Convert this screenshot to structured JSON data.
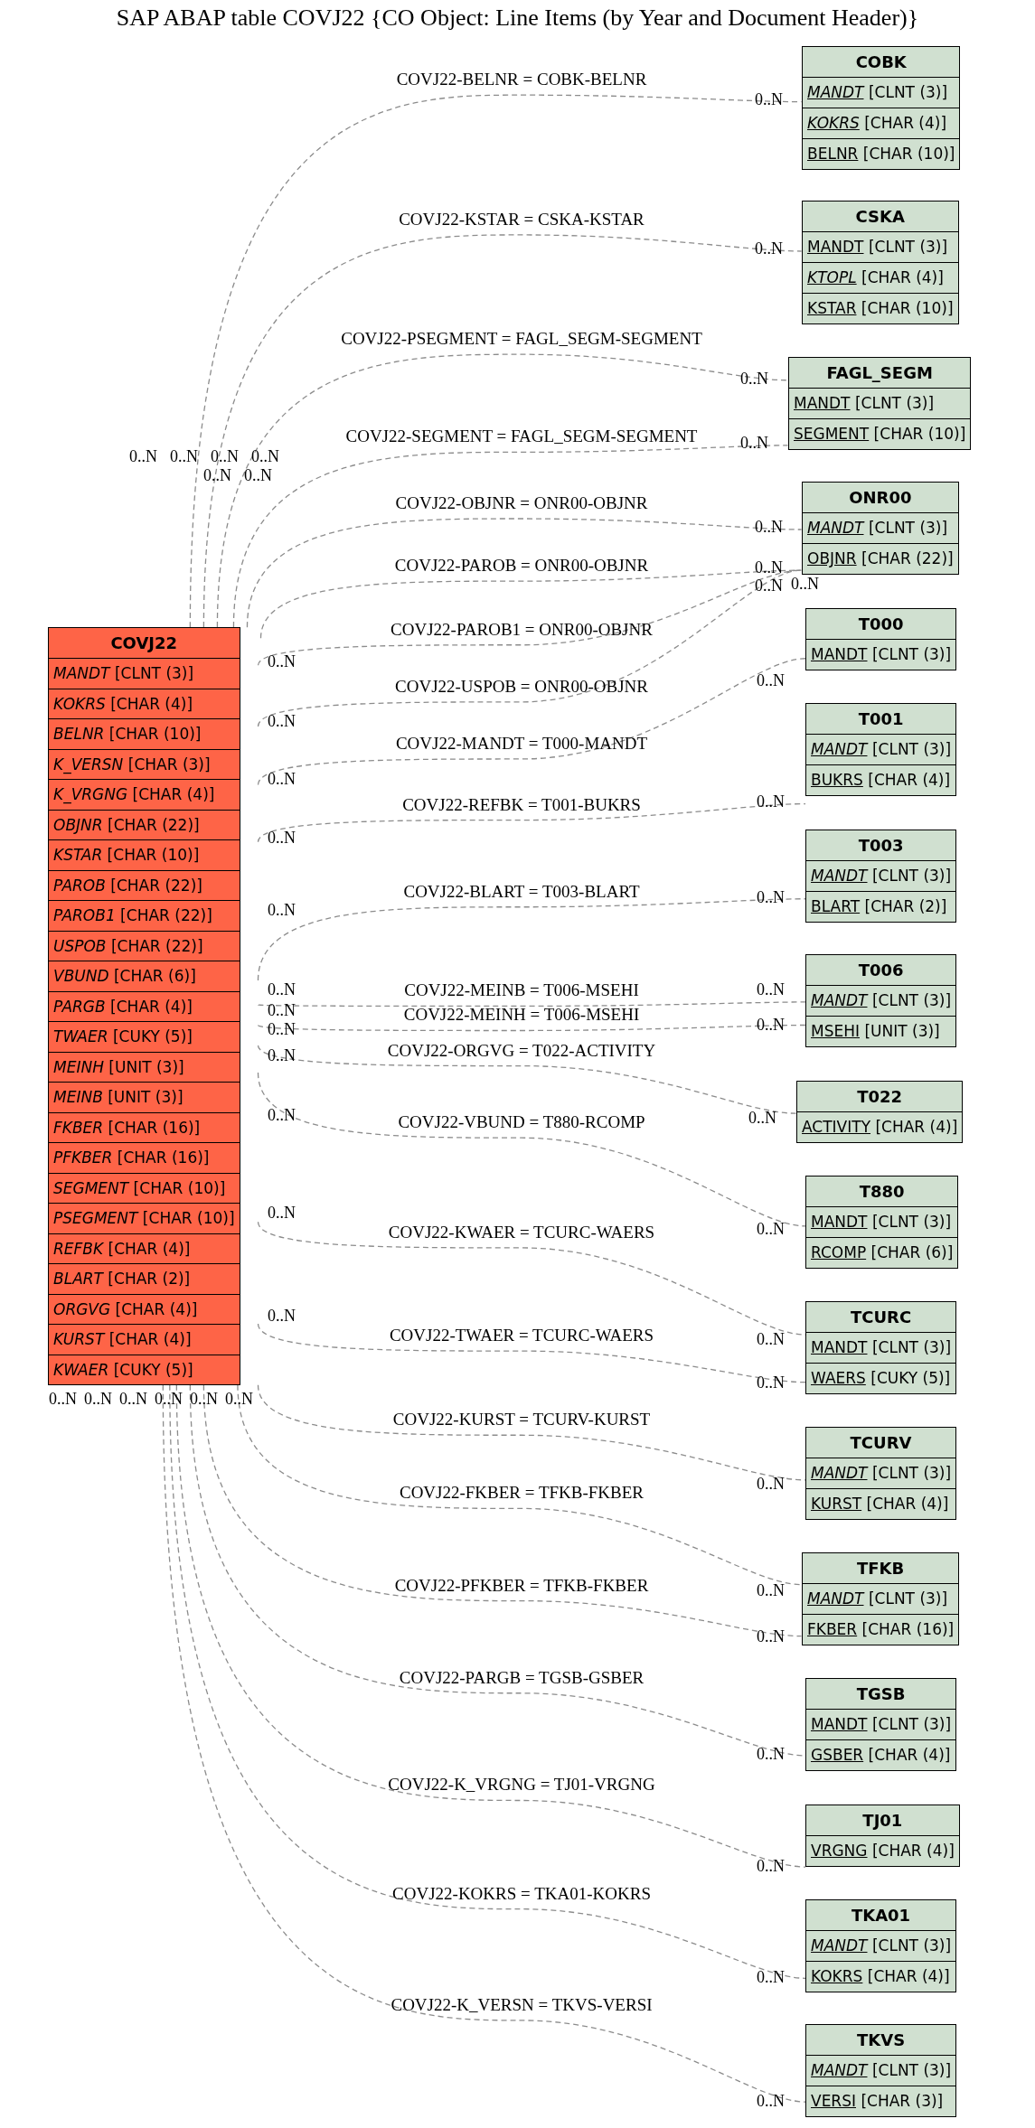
{
  "title": "SAP ABAP table COVJ22 {CO Object: Line Items (by Year and Document Header)}",
  "tables": [
    {
      "name": "COVJ22",
      "kind": "main",
      "fields": [
        {
          "name": "MANDT",
          "type": "[CLNT (3)]",
          "italic": true,
          "key": false
        },
        {
          "name": "KOKRS",
          "type": "[CHAR (4)]",
          "italic": true,
          "key": false
        },
        {
          "name": "BELNR",
          "type": "[CHAR (10)]",
          "italic": true,
          "key": false
        },
        {
          "name": "K_VERSN",
          "type": "[CHAR (3)]",
          "italic": true,
          "key": false
        },
        {
          "name": "K_VRGNG",
          "type": "[CHAR (4)]",
          "italic": true,
          "key": false
        },
        {
          "name": "OBJNR",
          "type": "[CHAR (22)]",
          "italic": true,
          "key": false
        },
        {
          "name": "KSTAR",
          "type": "[CHAR (10)]",
          "italic": true,
          "key": false
        },
        {
          "name": "PAROB",
          "type": "[CHAR (22)]",
          "italic": true,
          "key": false
        },
        {
          "name": "PAROB1",
          "type": "[CHAR (22)]",
          "italic": true,
          "key": false
        },
        {
          "name": "USPOB",
          "type": "[CHAR (22)]",
          "italic": true,
          "key": false
        },
        {
          "name": "VBUND",
          "type": "[CHAR (6)]",
          "italic": true,
          "key": false
        },
        {
          "name": "PARGB",
          "type": "[CHAR (4)]",
          "italic": true,
          "key": false
        },
        {
          "name": "TWAER",
          "type": "[CUKY (5)]",
          "italic": true,
          "key": false
        },
        {
          "name": "MEINH",
          "type": "[UNIT (3)]",
          "italic": true,
          "key": false
        },
        {
          "name": "MEINB",
          "type": "[UNIT (3)]",
          "italic": true,
          "key": false
        },
        {
          "name": "FKBER",
          "type": "[CHAR (16)]",
          "italic": true,
          "key": false
        },
        {
          "name": "PFKBER",
          "type": "[CHAR (16)]",
          "italic": true,
          "key": false
        },
        {
          "name": "SEGMENT",
          "type": "[CHAR (10)]",
          "italic": true,
          "key": false
        },
        {
          "name": "PSEGMENT",
          "type": "[CHAR (10)]",
          "italic": true,
          "key": false
        },
        {
          "name": "REFBK",
          "type": "[CHAR (4)]",
          "italic": true,
          "key": false
        },
        {
          "name": "BLART",
          "type": "[CHAR (2)]",
          "italic": true,
          "key": false
        },
        {
          "name": "ORGVG",
          "type": "[CHAR (4)]",
          "italic": true,
          "key": false
        },
        {
          "name": "KURST",
          "type": "[CHAR (4)]",
          "italic": true,
          "key": false
        },
        {
          "name": "KWAER",
          "type": "[CUKY (5)]",
          "italic": true,
          "key": false
        }
      ]
    },
    {
      "name": "COBK",
      "kind": "ref",
      "fields": [
        {
          "name": "MANDT",
          "type": "[CLNT (3)]",
          "italic": true,
          "key": true
        },
        {
          "name": "KOKRS",
          "type": "[CHAR (4)]",
          "italic": true,
          "key": true
        },
        {
          "name": "BELNR",
          "type": "[CHAR (10)]",
          "italic": false,
          "key": true
        }
      ]
    },
    {
      "name": "CSKA",
      "kind": "ref",
      "fields": [
        {
          "name": "MANDT",
          "type": "[CLNT (3)]",
          "italic": false,
          "key": true
        },
        {
          "name": "KTOPL",
          "type": "[CHAR (4)]",
          "italic": true,
          "key": true
        },
        {
          "name": "KSTAR",
          "type": "[CHAR (10)]",
          "italic": false,
          "key": true
        }
      ]
    },
    {
      "name": "FAGL_SEGM",
      "kind": "ref",
      "fields": [
        {
          "name": "MANDT",
          "type": "[CLNT (3)]",
          "italic": false,
          "key": true
        },
        {
          "name": "SEGMENT",
          "type": "[CHAR (10)]",
          "italic": false,
          "key": true
        }
      ]
    },
    {
      "name": "ONR00",
      "kind": "ref",
      "fields": [
        {
          "name": "MANDT",
          "type": "[CLNT (3)]",
          "italic": true,
          "key": true
        },
        {
          "name": "OBJNR",
          "type": "[CHAR (22)]",
          "italic": false,
          "key": true
        }
      ]
    },
    {
      "name": "T000",
      "kind": "ref",
      "fields": [
        {
          "name": "MANDT",
          "type": "[CLNT (3)]",
          "italic": false,
          "key": true
        }
      ]
    },
    {
      "name": "T001",
      "kind": "ref",
      "fields": [
        {
          "name": "MANDT",
          "type": "[CLNT (3)]",
          "italic": true,
          "key": true
        },
        {
          "name": "BUKRS",
          "type": "[CHAR (4)]",
          "italic": false,
          "key": true
        }
      ]
    },
    {
      "name": "T003",
      "kind": "ref",
      "fields": [
        {
          "name": "MANDT",
          "type": "[CLNT (3)]",
          "italic": true,
          "key": true
        },
        {
          "name": "BLART",
          "type": "[CHAR (2)]",
          "italic": false,
          "key": true
        }
      ]
    },
    {
      "name": "T006",
      "kind": "ref",
      "fields": [
        {
          "name": "MANDT",
          "type": "[CLNT (3)]",
          "italic": true,
          "key": true
        },
        {
          "name": "MSEHI",
          "type": "[UNIT (3)]",
          "italic": false,
          "key": true
        }
      ]
    },
    {
      "name": "T022",
      "kind": "ref",
      "fields": [
        {
          "name": "ACTIVITY",
          "type": "[CHAR (4)]",
          "italic": false,
          "key": true
        }
      ]
    },
    {
      "name": "T880",
      "kind": "ref",
      "fields": [
        {
          "name": "MANDT",
          "type": "[CLNT (3)]",
          "italic": false,
          "key": true
        },
        {
          "name": "RCOMP",
          "type": "[CHAR (6)]",
          "italic": false,
          "key": true
        }
      ]
    },
    {
      "name": "TCURC",
      "kind": "ref",
      "fields": [
        {
          "name": "MANDT",
          "type": "[CLNT (3)]",
          "italic": false,
          "key": true
        },
        {
          "name": "WAERS",
          "type": "[CUKY (5)]",
          "italic": false,
          "key": true
        }
      ]
    },
    {
      "name": "TCURV",
      "kind": "ref",
      "fields": [
        {
          "name": "MANDT",
          "type": "[CLNT (3)]",
          "italic": true,
          "key": true
        },
        {
          "name": "KURST",
          "type": "[CHAR (4)]",
          "italic": false,
          "key": true
        }
      ]
    },
    {
      "name": "TFKB",
      "kind": "ref",
      "fields": [
        {
          "name": "MANDT",
          "type": "[CLNT (3)]",
          "italic": true,
          "key": true
        },
        {
          "name": "FKBER",
          "type": "[CHAR (16)]",
          "italic": false,
          "key": true
        }
      ]
    },
    {
      "name": "TGSB",
      "kind": "ref",
      "fields": [
        {
          "name": "MANDT",
          "type": "[CLNT (3)]",
          "italic": false,
          "key": true
        },
        {
          "name": "GSBER",
          "type": "[CHAR (4)]",
          "italic": false,
          "key": true
        }
      ]
    },
    {
      "name": "TJ01",
      "kind": "ref",
      "fields": [
        {
          "name": "VRGNG",
          "type": "[CHAR (4)]",
          "italic": false,
          "key": true
        }
      ]
    },
    {
      "name": "TKA01",
      "kind": "ref",
      "fields": [
        {
          "name": "MANDT",
          "type": "[CLNT (3)]",
          "italic": true,
          "key": true
        },
        {
          "name": "KOKRS",
          "type": "[CHAR (4)]",
          "italic": false,
          "key": true
        }
      ]
    },
    {
      "name": "TKVS",
      "kind": "ref",
      "fields": [
        {
          "name": "MANDT",
          "type": "[CLNT (3)]",
          "italic": true,
          "key": true
        },
        {
          "name": "VERSI",
          "type": "[CHAR (3)]",
          "italic": false,
          "key": true
        }
      ]
    }
  ],
  "relations": [
    {
      "label": "COVJ22-BELNR = COBK-BELNR",
      "from_card": "0..N",
      "to_card": "0..N"
    },
    {
      "label": "COVJ22-KSTAR = CSKA-KSTAR",
      "from_card": "0..N",
      "to_card": "0..N"
    },
    {
      "label": "COVJ22-PSEGMENT = FAGL_SEGM-SEGMENT",
      "from_card": "0..N",
      "to_card": "0..N"
    },
    {
      "label": "COVJ22-SEGMENT = FAGL_SEGM-SEGMENT",
      "from_card": "0..N",
      "to_card": "0..N"
    },
    {
      "label": "COVJ22-OBJNR = ONR00-OBJNR",
      "from_card": "0..N",
      "to_card": "0..N"
    },
    {
      "label": "COVJ22-PAROB = ONR00-OBJNR",
      "from_card": "0..N",
      "to_card": "0..N"
    },
    {
      "label": "COVJ22-PAROB1 = ONR00-OBJNR",
      "from_card": "0..N",
      "to_card": "0..N"
    },
    {
      "label": "COVJ22-USPOB = ONR00-OBJNR",
      "from_card": "0..N",
      "to_card": "0..N"
    },
    {
      "label": "COVJ22-MANDT = T000-MANDT",
      "from_card": "0..N",
      "to_card": "0..N"
    },
    {
      "label": "COVJ22-REFBK = T001-BUKRS",
      "from_card": "0..N",
      "to_card": "0..N"
    },
    {
      "label": "COVJ22-BLART = T003-BLART",
      "from_card": "0..N",
      "to_card": "0..N"
    },
    {
      "label": "COVJ22-MEINB = T006-MSEHI",
      "from_card": "0..N",
      "to_card": "0..N"
    },
    {
      "label": "COVJ22-MEINH = T006-MSEHI",
      "from_card": "0..N",
      "to_card": "0..N"
    },
    {
      "label": "COVJ22-ORGVG = T022-ACTIVITY",
      "from_card": "0..N",
      "to_card": "0..N"
    },
    {
      "label": "COVJ22-VBUND = T880-RCOMP",
      "from_card": "0..N",
      "to_card": "0..N"
    },
    {
      "label": "COVJ22-KWAER = TCURC-WAERS",
      "from_card": "0..N",
      "to_card": "0..N"
    },
    {
      "label": "COVJ22-TWAER = TCURC-WAERS",
      "from_card": "0..N",
      "to_card": "0..N"
    },
    {
      "label": "COVJ22-KURST = TCURV-KURST",
      "from_card": "0..N",
      "to_card": "0..N"
    },
    {
      "label": "COVJ22-FKBER = TFKB-FKBER",
      "from_card": "0..N",
      "to_card": "0..N"
    },
    {
      "label": "COVJ22-PFKBER = TFKB-FKBER",
      "from_card": "0..N",
      "to_card": "0..N"
    },
    {
      "label": "COVJ22-PARGB = TGSB-GSBER",
      "from_card": "0..N",
      "to_card": "0..N"
    },
    {
      "label": "COVJ22-K_VRGNG = TJ01-VRGNG",
      "from_card": "0..N",
      "to_card": "0..N"
    },
    {
      "label": "COVJ22-KOKRS = TKA01-KOKRS",
      "from_card": "0..N",
      "to_card": "0..N"
    },
    {
      "label": "COVJ22-K_VERSN = TKVS-VERSI",
      "from_card": "0..N",
      "to_card": "0..N"
    }
  ]
}
